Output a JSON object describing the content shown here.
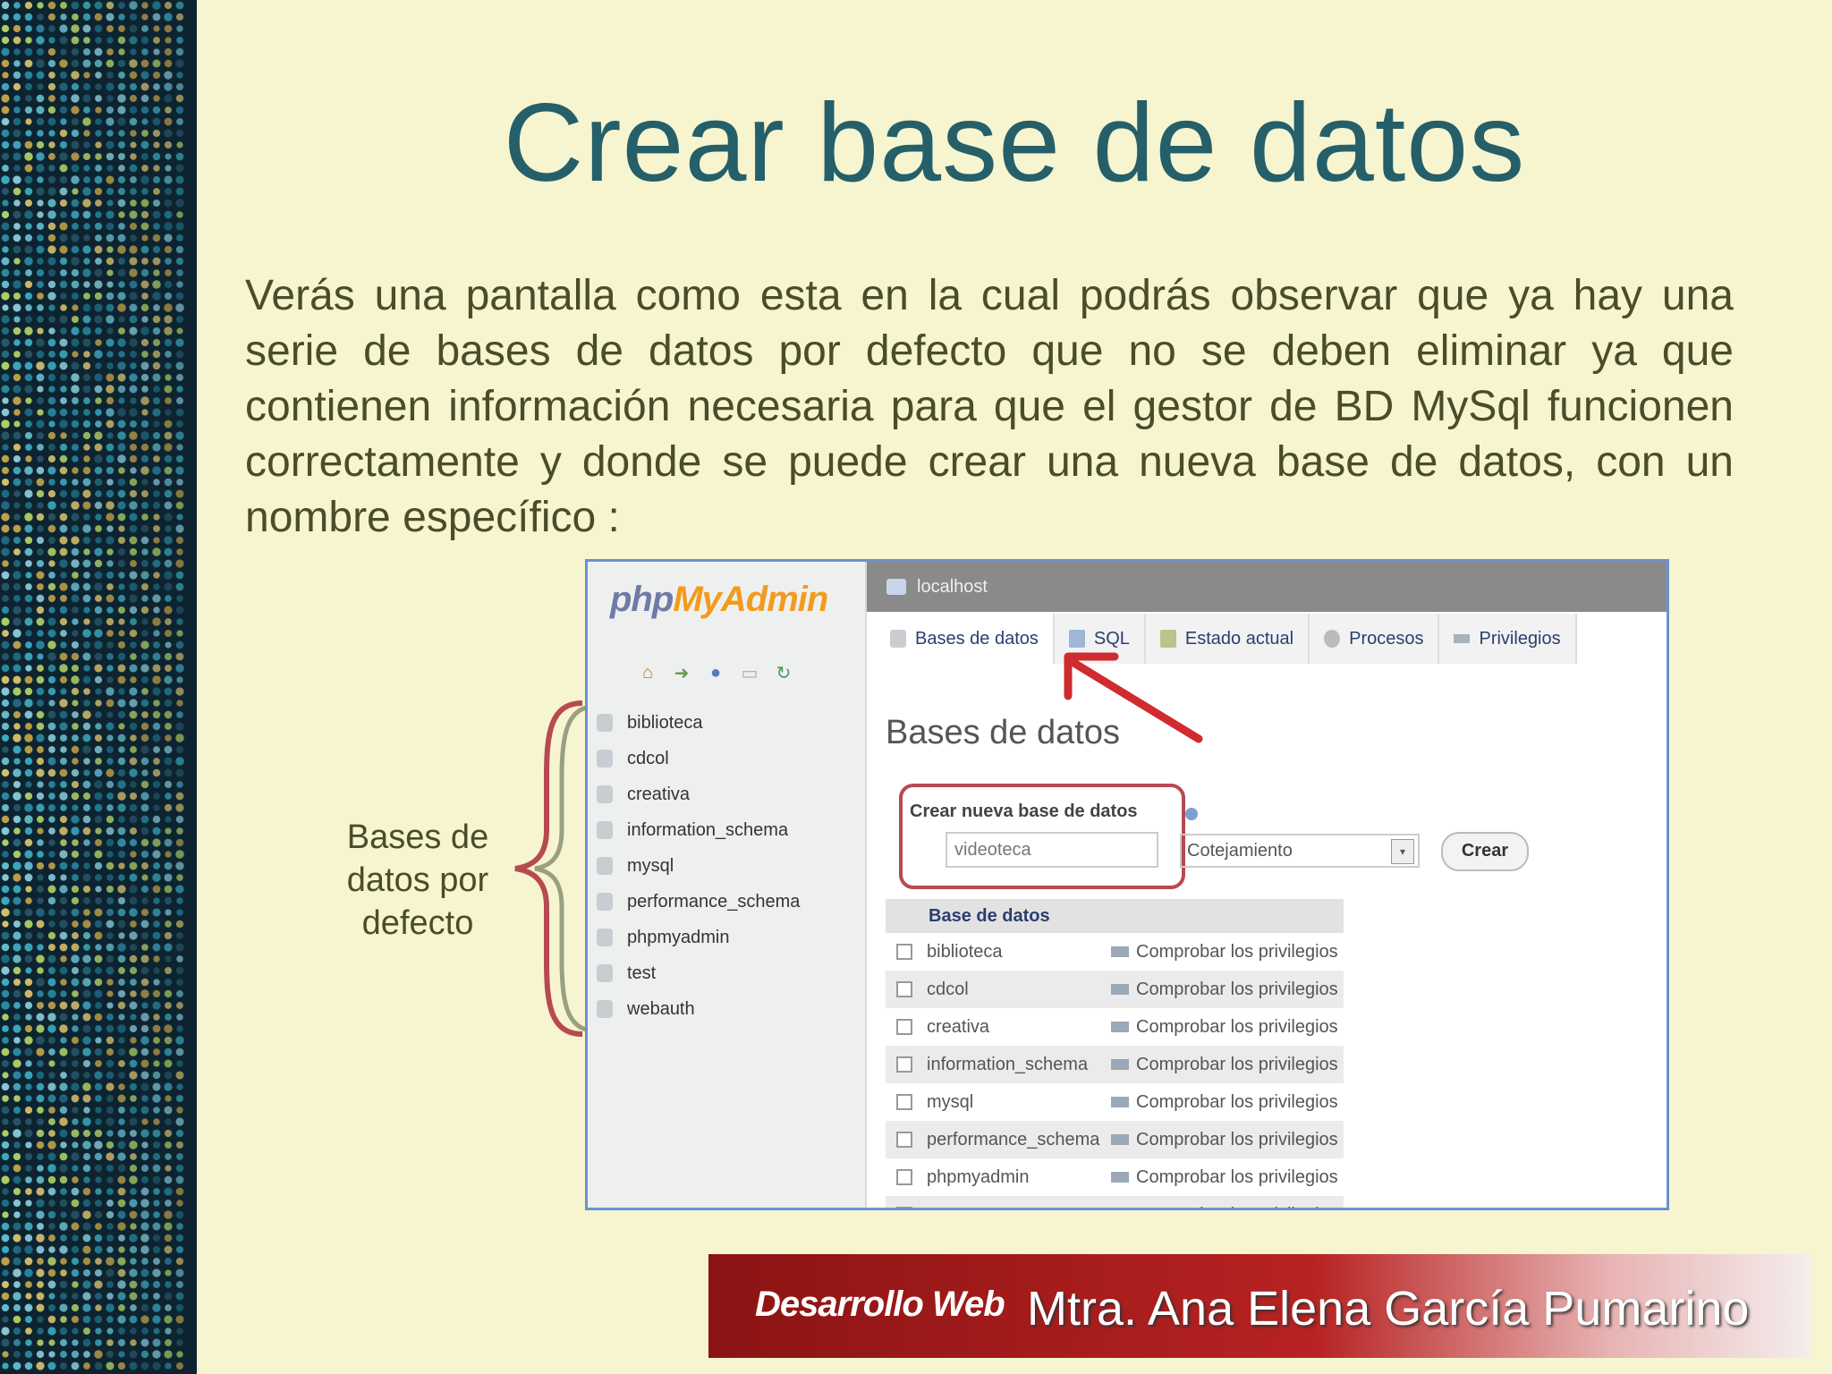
{
  "slide": {
    "title": "Crear base de datos",
    "body": "Verás una pantalla como esta en la cual podrás observar que ya hay una serie de bases de datos por defecto que no se deben eliminar ya que contienen información necesaria para que el gestor de BD MySql funcionen correctamente y donde se puede crear una nueva base de datos, con un nombre específico :",
    "side_label": "Bases de datos por defecto"
  },
  "pma": {
    "logo_php": "php",
    "logo_myadmin": "MyAdmin",
    "server": "localhost",
    "tabs": [
      {
        "label": "Bases de datos"
      },
      {
        "label": "SQL"
      },
      {
        "label": "Estado actual"
      },
      {
        "label": "Procesos"
      },
      {
        "label": "Privilegios"
      }
    ],
    "heading": "Bases de datos",
    "create_label": "Crear nueva base de datos",
    "new_db_value": "videoteca",
    "collation_value": "Cotejamiento",
    "create_button": "Crear",
    "column_header": "Base de datos",
    "sidebar_dbs": [
      "biblioteca",
      "cdcol",
      "creativa",
      "information_schema",
      "mysql",
      "performance_schema",
      "phpmyadmin",
      "test",
      "webauth"
    ],
    "table_rows": [
      {
        "name": "biblioteca",
        "priv": "Comprobar los privilegios"
      },
      {
        "name": "cdcol",
        "priv": "Comprobar los privilegios"
      },
      {
        "name": "creativa",
        "priv": "Comprobar los privilegios"
      },
      {
        "name": "information_schema",
        "priv": "Comprobar los privilegios"
      },
      {
        "name": "mysql",
        "priv": "Comprobar los privilegios"
      },
      {
        "name": "performance_schema",
        "priv": "Comprobar los privilegios"
      },
      {
        "name": "phpmyadmin",
        "priv": "Comprobar los privilegios"
      },
      {
        "name": "test",
        "priv": "Comprobar los privilegios"
      }
    ]
  },
  "footer": {
    "brand": "Desarrollo Web",
    "author": "Mtra. Ana Elena García Pumarino"
  },
  "colors": {
    "background": "#f6f5cf",
    "title": "#255f6a",
    "accent_red": "#b84950",
    "footer_red": "#9f1b1b"
  }
}
